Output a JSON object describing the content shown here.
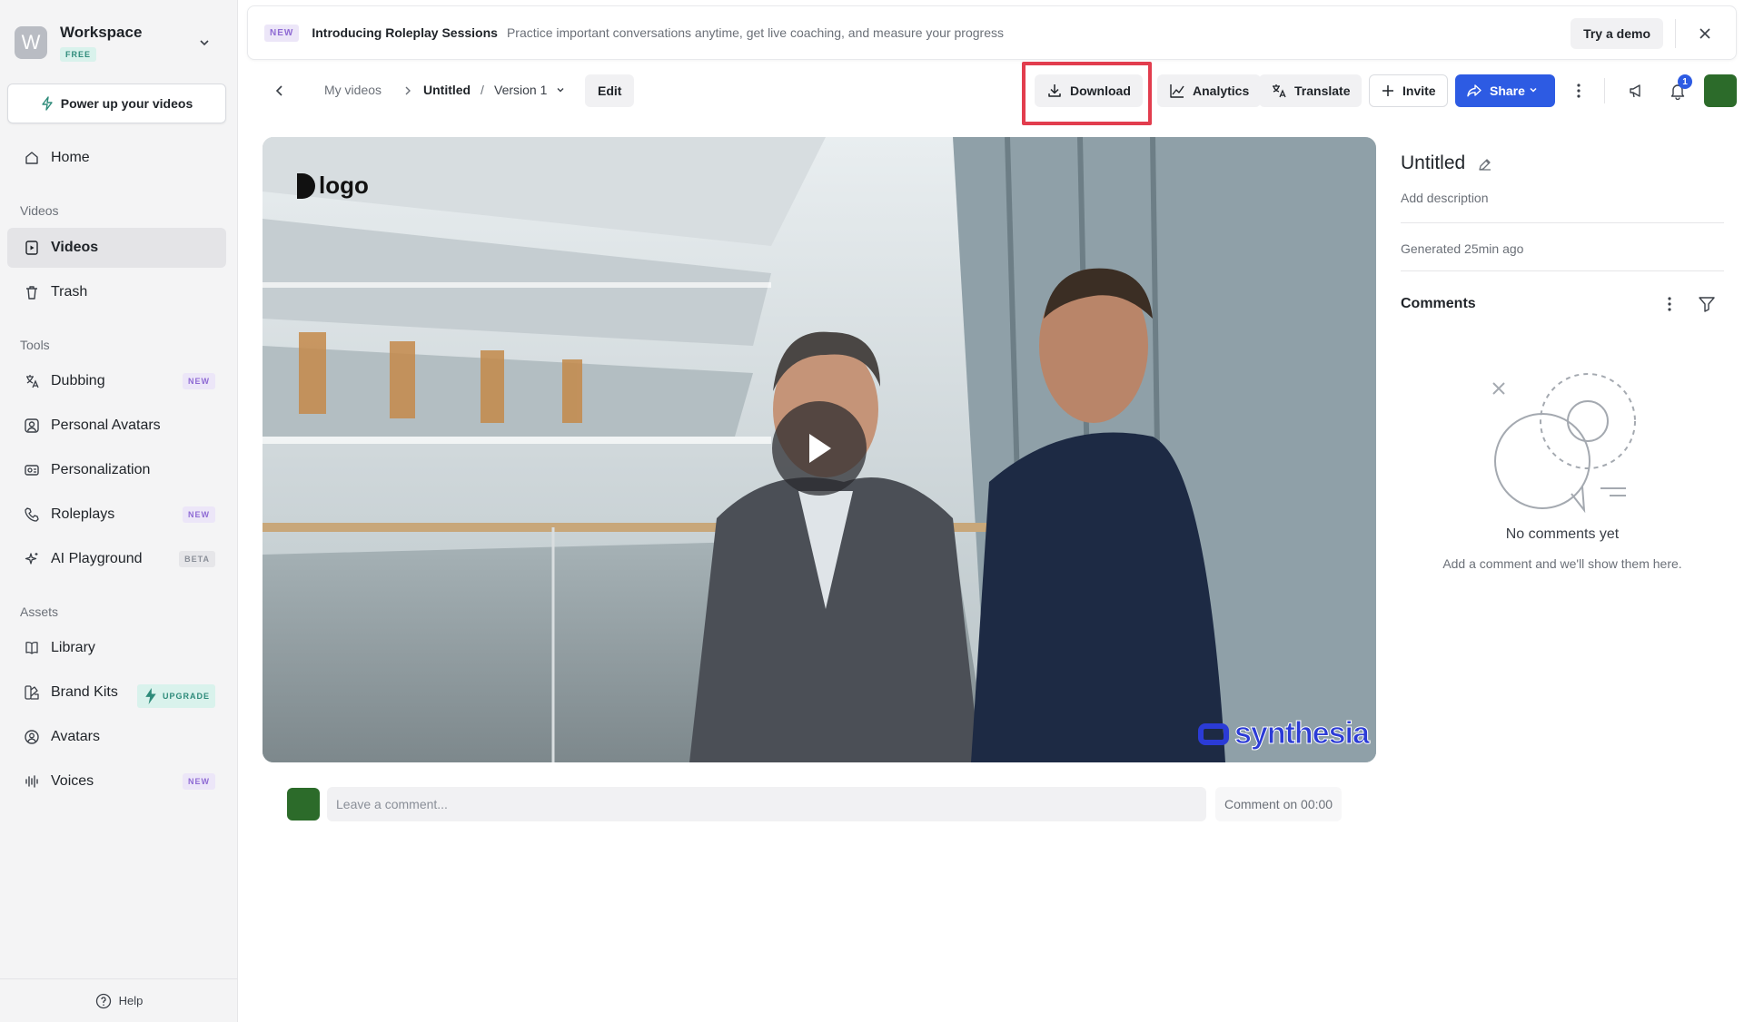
{
  "workspace": {
    "name": "Workspace",
    "plan": "FREE",
    "avatar_letter": "W"
  },
  "power_button": "Power up your videos",
  "sidebar": {
    "home": "Home",
    "videos_section": "Videos",
    "videos": "Videos",
    "trash": "Trash",
    "tools_section": "Tools",
    "tools": [
      {
        "label": "Dubbing",
        "badge": "NEW",
        "icon": "dubbing-icon"
      },
      {
        "label": "Personal Avatars",
        "badge": "",
        "icon": "person-icon"
      },
      {
        "label": "Personalization",
        "badge": "",
        "icon": "personalization-icon"
      },
      {
        "label": "Roleplays",
        "badge": "NEW",
        "icon": "phone-icon"
      },
      {
        "label": "AI Playground",
        "badge": "BETA",
        "icon": "sparkle-icon"
      }
    ],
    "assets_section": "Assets",
    "assets": [
      {
        "label": "Library",
        "badge": "",
        "icon": "book-icon"
      },
      {
        "label": "Brand Kits",
        "badge": "UPGRADE",
        "icon": "brand-icon"
      },
      {
        "label": "Avatars",
        "badge": "",
        "icon": "avatar-icon"
      },
      {
        "label": "Voices",
        "badge": "NEW",
        "icon": "waveform-icon"
      }
    ],
    "help": "Help"
  },
  "banner": {
    "tag": "NEW",
    "title": "Introducing Roleplay Sessions",
    "text": "Practice important conversations anytime, get live coaching, and measure your progress",
    "demo_button": "Try a demo"
  },
  "breadcrumb": {
    "root": "My videos",
    "current": "Untitled",
    "separator": "/",
    "version": "Version 1"
  },
  "toolbar": {
    "edit": "Edit",
    "download": "Download",
    "analytics": "Analytics",
    "translate": "Translate",
    "invite": "Invite",
    "share": "Share",
    "notification_count": "1"
  },
  "video": {
    "logo_text": "logo",
    "watermark": "synthesia"
  },
  "comment_bar": {
    "placeholder": "Leave a comment...",
    "timestamp": "Comment on 00:00"
  },
  "details": {
    "title": "Untitled",
    "description_placeholder": "Add description",
    "generated": "Generated 25min ago",
    "comments_heading": "Comments",
    "empty_title": "No comments yet",
    "empty_subtitle": "Add a comment and we'll show them here."
  },
  "colors": {
    "accent": "#2d5be3",
    "highlight": "#e23d4e",
    "avatar_green": "#2c6b2a",
    "sidebar_bg": "#f4f4f5"
  }
}
